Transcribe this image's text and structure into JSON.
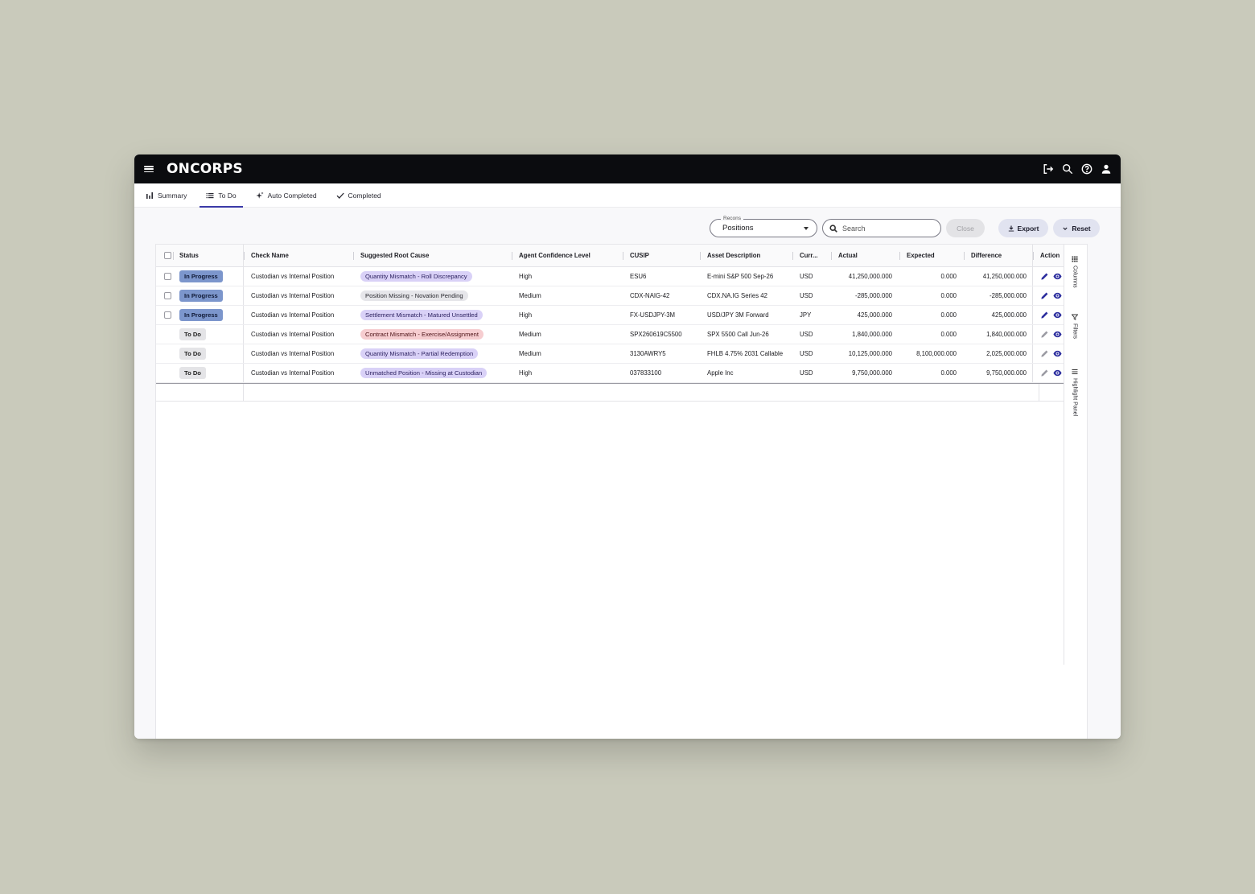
{
  "app": {
    "logo": "ONCORPS"
  },
  "topbar_icons": [
    "logout-icon",
    "search-icon",
    "help-icon",
    "user-icon"
  ],
  "tabs": [
    {
      "label": "Summary",
      "icon": "bar-chart-icon",
      "active": false
    },
    {
      "label": "To Do",
      "icon": "list-icon",
      "active": true
    },
    {
      "label": "Auto Completed",
      "icon": "sparkle-icon",
      "active": false
    },
    {
      "label": "Completed",
      "icon": "check-icon",
      "active": false
    }
  ],
  "toolbar": {
    "recons_label": "Recons",
    "recons_value": "Positions",
    "search_placeholder": "Search",
    "close_label": "Close",
    "export_label": "Export",
    "reset_label": "Reset"
  },
  "columns": {
    "status": "Status",
    "check_name": "Check Name",
    "root_cause": "Suggested Root Cause",
    "confidence": "Agent Confidence Level",
    "cusip": "CUSIP",
    "asset": "Asset Description",
    "currency": "Curr...",
    "actual": "Actual",
    "expected": "Expected",
    "difference": "Difference",
    "action": "Action"
  },
  "rows": [
    {
      "checkbox": true,
      "status": "In Progress",
      "status_type": "inprog",
      "check_name": "Custodian vs Internal Position",
      "root_cause": "Quantity Mismatch - Roll Discrepancy",
      "cause_color": "purple",
      "confidence": "High",
      "cusip": "ESU6",
      "asset": "E-mini S&P 500 Sep-26",
      "currency": "USD",
      "actual": "41,250,000.000",
      "expected": "0.000",
      "difference": "41,250,000.000",
      "editable": true
    },
    {
      "checkbox": true,
      "status": "In Progress",
      "status_type": "inprog",
      "check_name": "Custodian vs Internal Position",
      "root_cause": "Position Missing - Novation Pending",
      "cause_color": "gray",
      "confidence": "Medium",
      "cusip": "CDX-NAIG-42",
      "asset": "CDX.NA.IG Series 42",
      "currency": "USD",
      "actual": "-285,000.000",
      "expected": "0.000",
      "difference": "-285,000.000",
      "editable": true
    },
    {
      "checkbox": true,
      "status": "In Progress",
      "status_type": "inprog",
      "check_name": "Custodian vs Internal Position",
      "root_cause": "Settlement Mismatch - Matured Unsettled",
      "cause_color": "purple",
      "confidence": "High",
      "cusip": "FX-USDJPY-3M",
      "asset": "USD/JPY 3M Forward",
      "currency": "JPY",
      "actual": "425,000.000",
      "expected": "0.000",
      "difference": "425,000.000",
      "editable": true
    },
    {
      "checkbox": false,
      "status": "To Do",
      "status_type": "todo",
      "check_name": "Custodian vs Internal Position",
      "root_cause": "Contract Mismatch - Exercise/Assignment",
      "cause_color": "red",
      "confidence": "Medium",
      "cusip": "SPX260619C5500",
      "asset": "SPX 5500 Call Jun-26",
      "currency": "USD",
      "actual": "1,840,000.000",
      "expected": "0.000",
      "difference": "1,840,000.000",
      "editable": false
    },
    {
      "checkbox": false,
      "status": "To Do",
      "status_type": "todo",
      "check_name": "Custodian vs Internal Position",
      "root_cause": "Quantity Mismatch - Partial Redemption",
      "cause_color": "purple",
      "confidence": "Medium",
      "cusip": "3130AWRY5",
      "asset": "FHLB 4.75% 2031 Callable",
      "currency": "USD",
      "actual": "10,125,000.000",
      "expected": "8,100,000.000",
      "difference": "2,025,000.000",
      "editable": false
    },
    {
      "checkbox": false,
      "status": "To Do",
      "status_type": "todo",
      "check_name": "Custodian vs Internal Position",
      "root_cause": "Unmatched Position - Missing at Custodian",
      "cause_color": "purple",
      "confidence": "High",
      "cusip": "037833100",
      "asset": "Apple Inc",
      "currency": "USD",
      "actual": "9,750,000.000",
      "expected": "0.000",
      "difference": "9,750,000.000",
      "editable": false
    }
  ],
  "side_panel": [
    {
      "label": "Columns",
      "icon": "columns-icon"
    },
    {
      "label": "Filters",
      "icon": "filter-icon"
    },
    {
      "label": "Highlight Panel",
      "icon": "highlight-panel-icon"
    }
  ],
  "colors": {
    "accent": "#3b3aa8",
    "in_progress": "#7c96cc",
    "topbar": "#0b0c0f"
  }
}
